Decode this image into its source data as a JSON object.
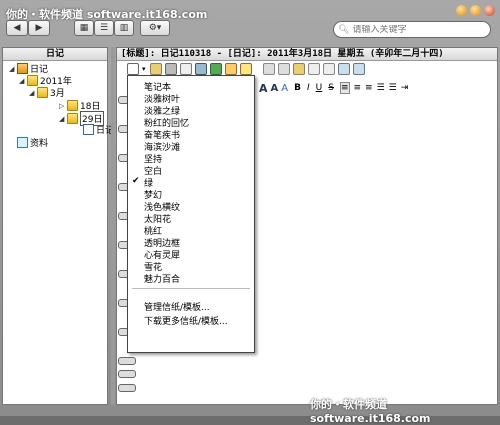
{
  "watermark": {
    "top": "你的・软件频道 software.it168.com",
    "bottom": "你的・软件频道 software.it168.com"
  },
  "toolbar": {
    "back": "◀",
    "forward": "▶",
    "gear": "⚙▾"
  },
  "search": {
    "placeholder": "请输入关键字"
  },
  "left": {
    "header": "日记",
    "items": [
      "日记",
      "2011年",
      "3月",
      "18日",
      "29日",
      "日记",
      "资料"
    ]
  },
  "main": {
    "header": "[标题]: 日记110318 - [日记]: 2011年3月18日 星期五   (辛卯年二月十四)"
  },
  "menu": {
    "items": [
      "笔记本",
      "淡雅树叶",
      "淡雅之绿",
      "粉红的回忆",
      "奋笔疾书",
      "海滨沙滩",
      "坚持",
      "空白",
      "绿",
      "梦幻",
      "浅色横纹",
      "太阳花",
      "桃红",
      "透明边框",
      "心有灵犀",
      "雪花",
      "魅力百合"
    ],
    "checked_index": 8,
    "actions": [
      "管理信纸/模板...",
      "下载更多信纸/模板..."
    ]
  },
  "format": {
    "bold": "B",
    "italic": "I",
    "underline": "U",
    "strike": "S"
  }
}
